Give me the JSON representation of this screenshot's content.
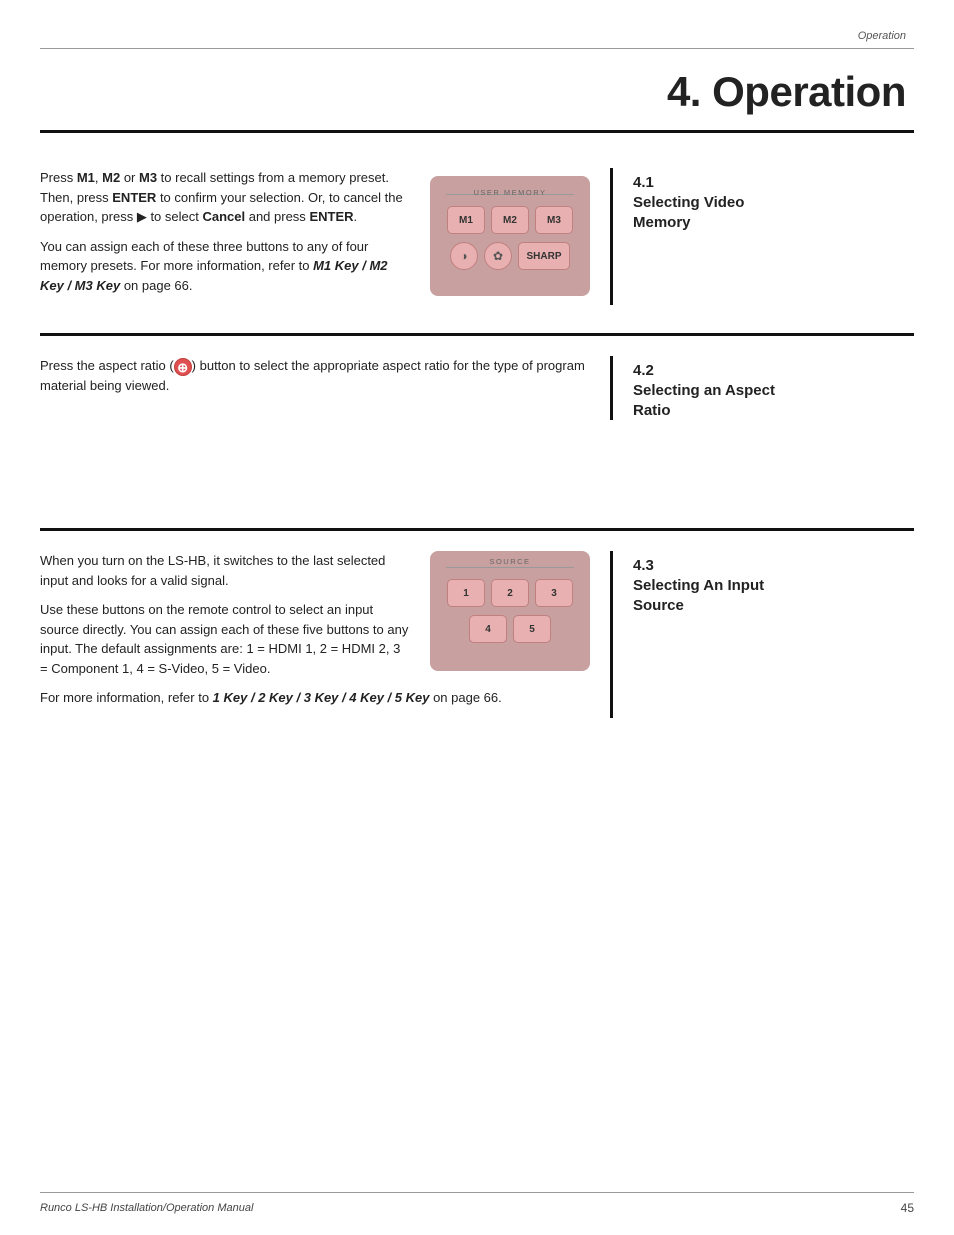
{
  "header": {
    "label": "Operation"
  },
  "chapter": {
    "title": "4. Operation"
  },
  "section41": {
    "num": "4.1",
    "title": "Selecting Video\nMemory",
    "para1": "Press M1, M2 or M3 to recall settings from a memory preset. Then, press ENTER to confirm your selection. Or, to cancel the operation, press ► to select Cancel and press ENTER.",
    "para2": "You can assign each of these three buttons to any of four memory presets. For more information, refer to M1 Key / M2 Key / M3 Key on page 66.",
    "remote": {
      "label": "USER MEMORY",
      "row1": [
        "M1",
        "M2",
        "M3"
      ],
      "row2_icons": [
        "●",
        "☀",
        "SHARP"
      ]
    }
  },
  "section42": {
    "num": "4.2",
    "title": "Selecting an Aspect\nRatio",
    "para1": "Press the aspect ratio (⊕) button to select the appropriate aspect ratio for the type of program material being viewed."
  },
  "section43": {
    "num": "4.3",
    "title": "Selecting An Input\nSource",
    "para1": "When you turn on the LS-HB, it switches to the last selected input and looks for a valid signal.",
    "para2": "Use these buttons on the remote control to select an input source directly. You can assign each of these five buttons to any input. The default assignments are: 1 = HDMI 1, 2 = HDMI 2, 3 = Component 1, 4 = S-Video, 5 = Video.",
    "para3": "For more information, refer to 1 Key / 2 Key / 3 Key / 4 Key / 5 Key on page 66.",
    "remote": {
      "label": "SOURCE",
      "row1": [
        "1",
        "2",
        "3"
      ],
      "row2": [
        "4",
        "5"
      ]
    }
  },
  "footer": {
    "left": "Runco LS-HB Installation/Operation Manual",
    "right": "45"
  }
}
